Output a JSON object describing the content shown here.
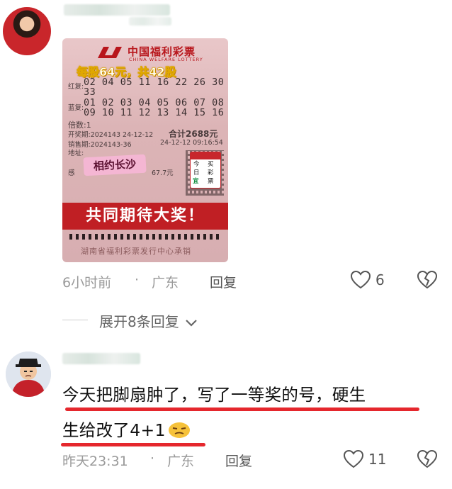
{
  "comments": [
    {
      "ticket": {
        "logo_cn": "中国福利彩票",
        "logo_en": "CHINA WELFARE LOTTERY",
        "promo": "每股64元，共42股",
        "red_label": "红复:",
        "red_line1": "02 04 05 11 16 22 26 30",
        "red_line2": "33",
        "blue_label": "蓝复:",
        "blue_line1": "01 02 03 04 05 06 07 08",
        "blue_line2": "09 10 11 12 13 14 15 16",
        "multiple": "倍数:1",
        "draw": "开奖期:2024143 24-12-12",
        "total": "合计2688元",
        "sale": "销售期:2024143-36",
        "sale_time": "24-12-12 09:16:54",
        "address": "地址:",
        "misc": "感",
        "misc_amount": "67.7元",
        "sticker": "相约长沙",
        "buy_line1": "今",
        "buy_line2": "日",
        "buy_line3": "宜",
        "buy_right1": "买",
        "buy_right2": "彩",
        "buy_right3": "票",
        "banner": "共同期待大奖！",
        "footer": "湖南省福利彩票发行中心承销"
      },
      "time": "6小时前",
      "location": "广东",
      "reply_label": "回复",
      "like_count": "6",
      "expand_label": "展开8条回复"
    },
    {
      "text_line1": "今天把脚扇肿了，写了一等奖的号，硬生",
      "text_line2": "生给改了4+1",
      "time": "昨天23:31",
      "location": "广东",
      "reply_label": "回复",
      "like_count": "11"
    }
  ],
  "separator": "·",
  "colors": {
    "underline": "#e5272d",
    "ticket_banner": "#c01f24",
    "meta": "#9a9a9a"
  },
  "icons": [
    "heart-icon",
    "broken-heart-icon",
    "chevron-down-icon",
    "smirk-emoji-icon"
  ]
}
